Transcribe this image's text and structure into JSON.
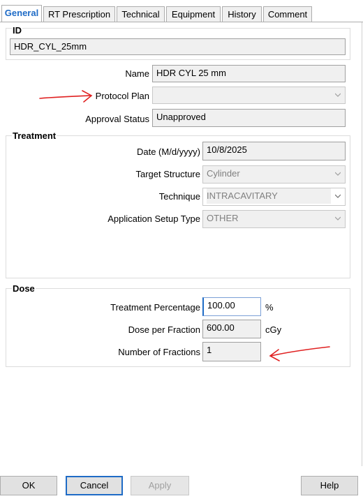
{
  "tabs": [
    {
      "label": "General",
      "active": true
    },
    {
      "label": "RT Prescription",
      "active": false
    },
    {
      "label": "Technical",
      "active": false
    },
    {
      "label": "Equipment",
      "active": false
    },
    {
      "label": "History",
      "active": false
    },
    {
      "label": "Comment",
      "active": false
    }
  ],
  "id_group": {
    "title": "ID",
    "value": "HDR_CYL_25mm"
  },
  "general": {
    "name_label": "Name",
    "name_value": "HDR CYL 25 mm",
    "protocol_label": "Protocol Plan",
    "protocol_value": "",
    "approval_label": "Approval Status",
    "approval_value": "Unapproved"
  },
  "treatment": {
    "title": "Treatment",
    "date_label": "Date (M/d/yyyy)",
    "date_value": "10/8/2025",
    "target_label": "Target Structure",
    "target_value": "Cylinder",
    "technique_label": "Technique",
    "technique_value": "INTRACAVITARY",
    "setup_label": "Application Setup Type",
    "setup_value": "OTHER"
  },
  "dose": {
    "title": "Dose",
    "percentage_label": "Treatment Percentage",
    "percentage_value": "100.00",
    "percentage_unit": "%",
    "per_fraction_label": "Dose per Fraction",
    "per_fraction_value": "600.00",
    "per_fraction_unit": "cGy",
    "fractions_label": "Number of Fractions",
    "fractions_value": "1"
  },
  "buttons": {
    "ok": "OK",
    "cancel": "Cancel",
    "apply": "Apply",
    "help": "Help"
  },
  "colors": {
    "active_tab": "#1e6bc6",
    "annotation_arrow": "#e02020",
    "primary_button_border": "#1e6bc6"
  }
}
